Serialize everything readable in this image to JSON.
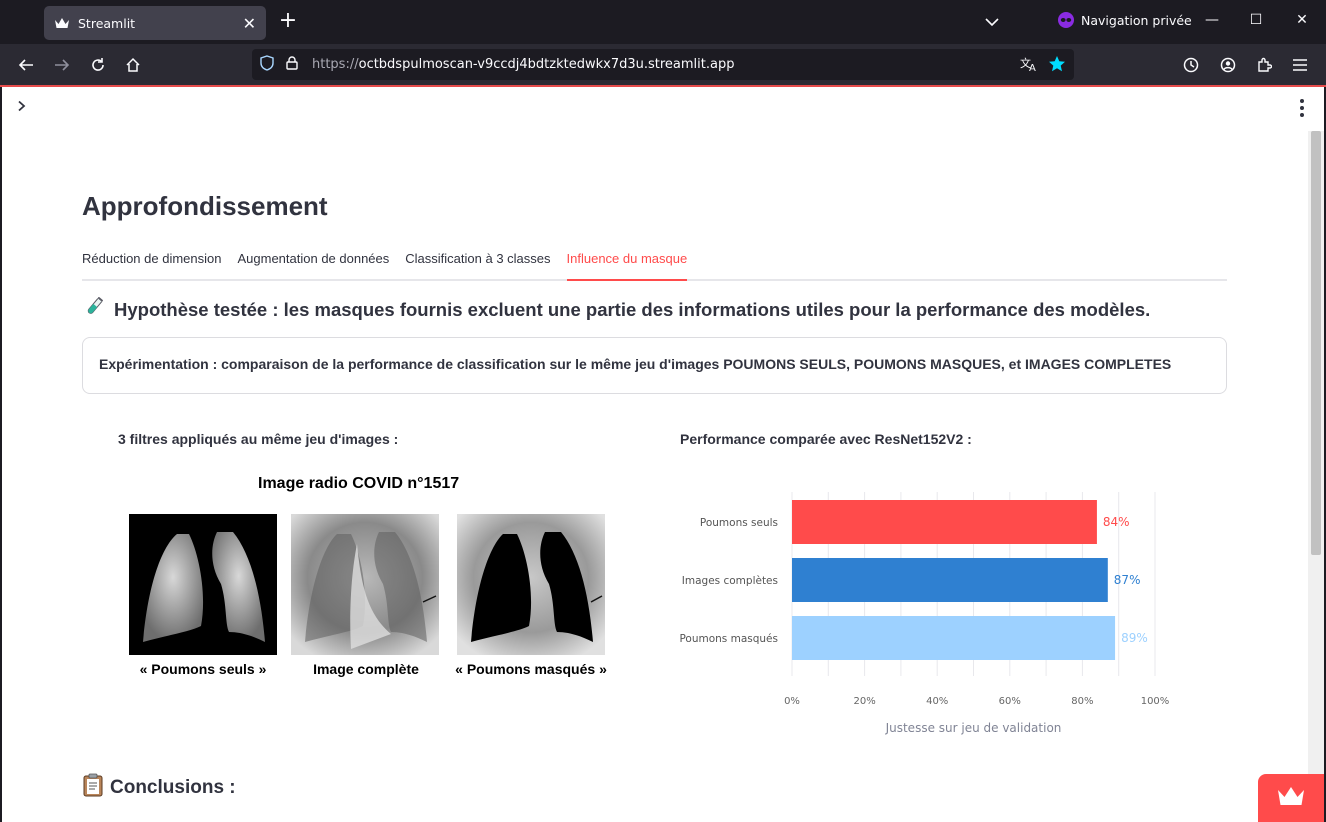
{
  "browser": {
    "tab_title": "Streamlit",
    "private_label": "Navigation privée",
    "url_proto": "https://",
    "url_host": "octbdspulmoscan-v9ccdj4bdtzktedwkx7d3u.streamlit.app"
  },
  "page": {
    "title": "Approfondissement",
    "tabs": [
      {
        "label": "Réduction de dimension",
        "active": false
      },
      {
        "label": "Augmentation de données",
        "active": false
      },
      {
        "label": "Classification à 3 classes",
        "active": false
      },
      {
        "label": "Influence du masque",
        "active": true
      }
    ],
    "hypothesis": "Hypothèse testée : les masques fournis excluent une partie des informations utiles pour la performance des modèles.",
    "experiment": "Expérimentation : comparaison de la performance de classification sur le même jeu d'images POUMONS SEULS, POUMONS MASQUES, et IMAGES COMPLETES",
    "left_title": "3 filtres appliqués au même jeu d'images :",
    "right_title": "Performance comparée avec ResNet152V2 :",
    "xray": {
      "title": "Image radio COVID n°1517",
      "labels": [
        "« Poumons seuls »",
        "Image complète",
        "« Poumons masqués »"
      ]
    },
    "conclusions": "Conclusions :"
  },
  "chart_data": {
    "type": "bar",
    "orientation": "horizontal",
    "categories": [
      "Poumons seuls",
      "Images complètes",
      "Poumons masqués"
    ],
    "values": [
      0.84,
      0.87,
      0.89
    ],
    "value_labels": [
      "84%",
      "87%",
      "89%"
    ],
    "colors": [
      "#ff4b4b",
      "#2f80d1",
      "#9dd1ff"
    ],
    "xlabel": "Justesse sur jeu de validation",
    "xlim": [
      0,
      1
    ],
    "xticks": [
      "0%",
      "20%",
      "40%",
      "60%",
      "80%",
      "100%"
    ],
    "grid": true
  }
}
